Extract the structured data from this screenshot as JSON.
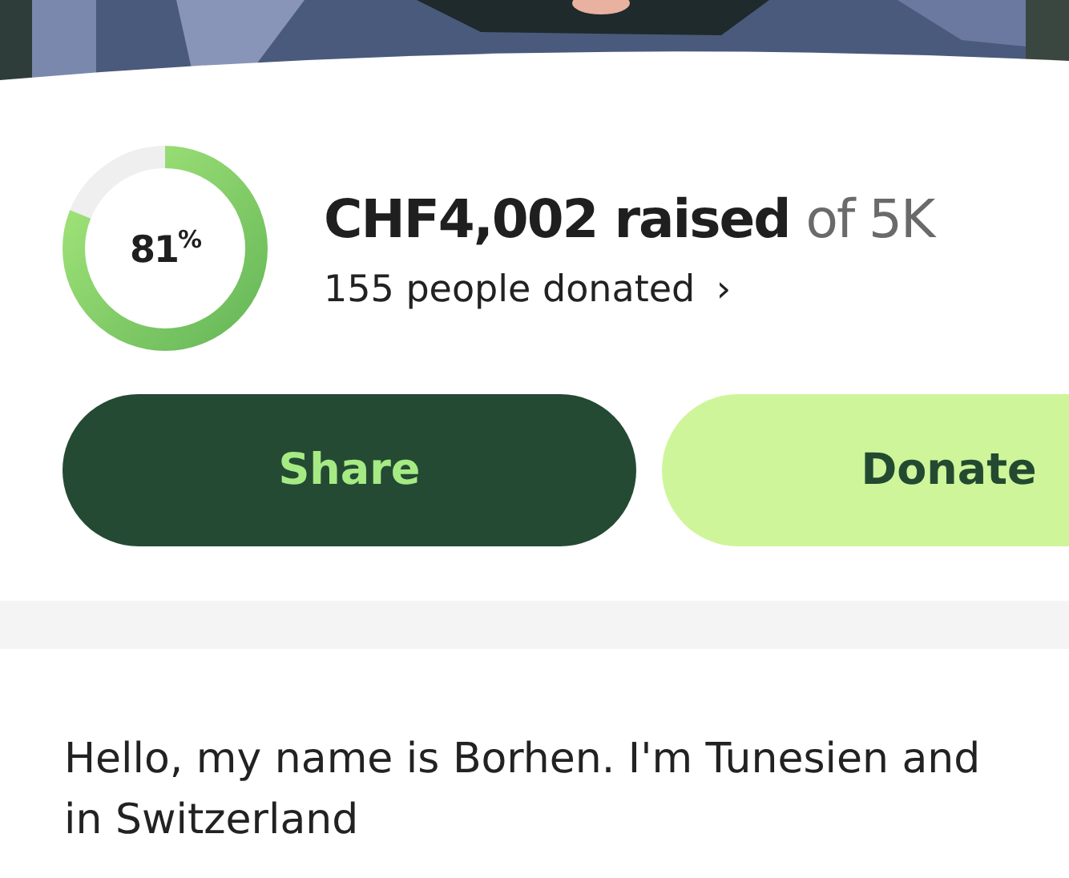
{
  "progress": {
    "level": 0.81,
    "percent": "81$^{%}$"
  },
  "raised": {
    "amount": "CHF4,002 raised",
    "goal": "of 5K"
  },
  "donors": {
    "label": "155 people donated",
    "chevron": "›"
  },
  "buttons": [
    {
      "label": "Share",
      "kind": "secondary"
    },
    {
      "label": "Donate",
      "kind": "primary"
    }
  ],
  "story": "Hello, my name is Borhen. I'm Tunesien and\nin Switzerland"
}
